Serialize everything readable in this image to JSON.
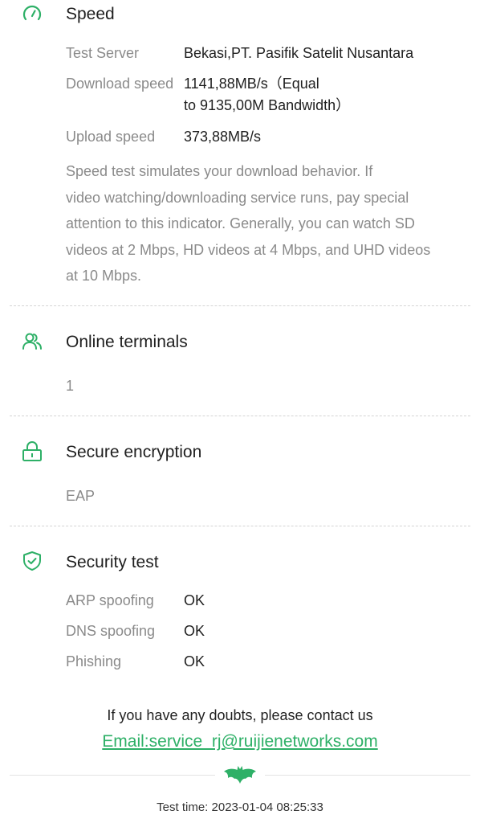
{
  "colors": {
    "accent": "#2eb067",
    "label": "#8a8a8a",
    "text": "#1f1f1f"
  },
  "speed": {
    "icon": "speedometer-icon",
    "title": "Speed",
    "rows": [
      {
        "label": "Test Server",
        "value": "Bekasi,PT. Pasifik Satelit Nusantara"
      },
      {
        "label": "Download speed",
        "value_line1": "1141,88MB/s（Equal",
        "value_line2": "to 9135,00M Bandwidth）"
      },
      {
        "label": "Upload speed",
        "value": "373,88MB/s"
      }
    ],
    "description_lines": [
      "Speed test simulates your download behavior. If",
      "video watching/downloading service runs, pay special",
      "attention to this indicator. Generally, you can watch SD",
      "videos at 2 Mbps, HD videos at 4 Mbps, and UHD videos",
      "at 10 Mbps."
    ]
  },
  "online_terminals": {
    "icon": "users-icon",
    "title": "Online terminals",
    "value": "1"
  },
  "secure_encryption": {
    "icon": "lock-icon",
    "title": "Secure encryption",
    "value": "EAP"
  },
  "security_test": {
    "icon": "shield-check-icon",
    "title": "Security test",
    "rows": [
      {
        "label": "ARP spoofing",
        "value": "OK"
      },
      {
        "label": "DNS spoofing",
        "value": "OK"
      },
      {
        "label": "Phishing",
        "value": "OK"
      }
    ]
  },
  "footer": {
    "contact_text": "If you have any doubts, please contact us",
    "email_link": "Email:service_rj@ruijienetworks.com",
    "logo_icon": "bat-logo-icon",
    "test_time": "Test time: 2023-01-04 08:25:33"
  }
}
